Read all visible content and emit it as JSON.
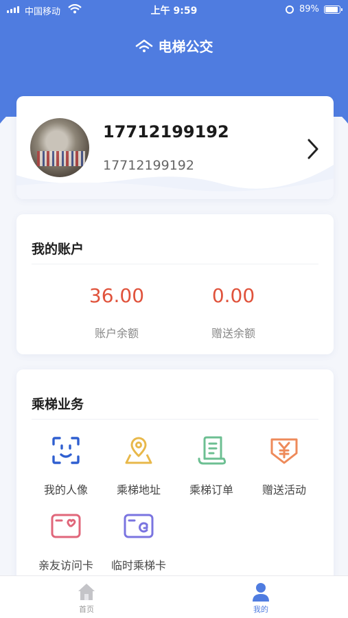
{
  "status_bar": {
    "carrier": "中国移动",
    "time": "上午 9:59",
    "battery": "89%",
    "battery_level": 0.89
  },
  "header": {
    "title": "电梯公交",
    "icon": "wifi-logo-icon"
  },
  "profile": {
    "name": "17712199192",
    "phone": "17712199192",
    "chevron_icon": "chevron-right-icon"
  },
  "account": {
    "title": "我的账户",
    "balance": {
      "value": "36.00",
      "label": "账户余额"
    },
    "gift": {
      "value": "0.00",
      "label": "赠送余额"
    }
  },
  "services": {
    "title": "乘梯业务",
    "items": [
      {
        "label": "我的人像",
        "icon": "face-scan-icon",
        "color": "#2f5fd0"
      },
      {
        "label": "乘梯地址",
        "icon": "location-pin-icon",
        "color": "#e8b84a"
      },
      {
        "label": "乘梯订单",
        "icon": "receipt-scroll-icon",
        "color": "#6cbf92"
      },
      {
        "label": "赠送活动",
        "icon": "yen-gift-icon",
        "color": "#ee8a5a"
      },
      {
        "label": "亲友访问卡",
        "icon": "heart-card-icon",
        "color": "#e0667a"
      },
      {
        "label": "临时乘梯卡",
        "icon": "temp-card-icon",
        "color": "#7a74e0"
      }
    ]
  },
  "tabbar": {
    "tabs": [
      {
        "label": "首页",
        "icon": "home-icon",
        "active": false
      },
      {
        "label": "我的",
        "icon": "person-icon",
        "active": true
      }
    ],
    "active_color": "#4f7ce0",
    "inactive_color": "#999999"
  },
  "colors": {
    "brand": "#4f7ce0",
    "amount": "#e0533c"
  }
}
